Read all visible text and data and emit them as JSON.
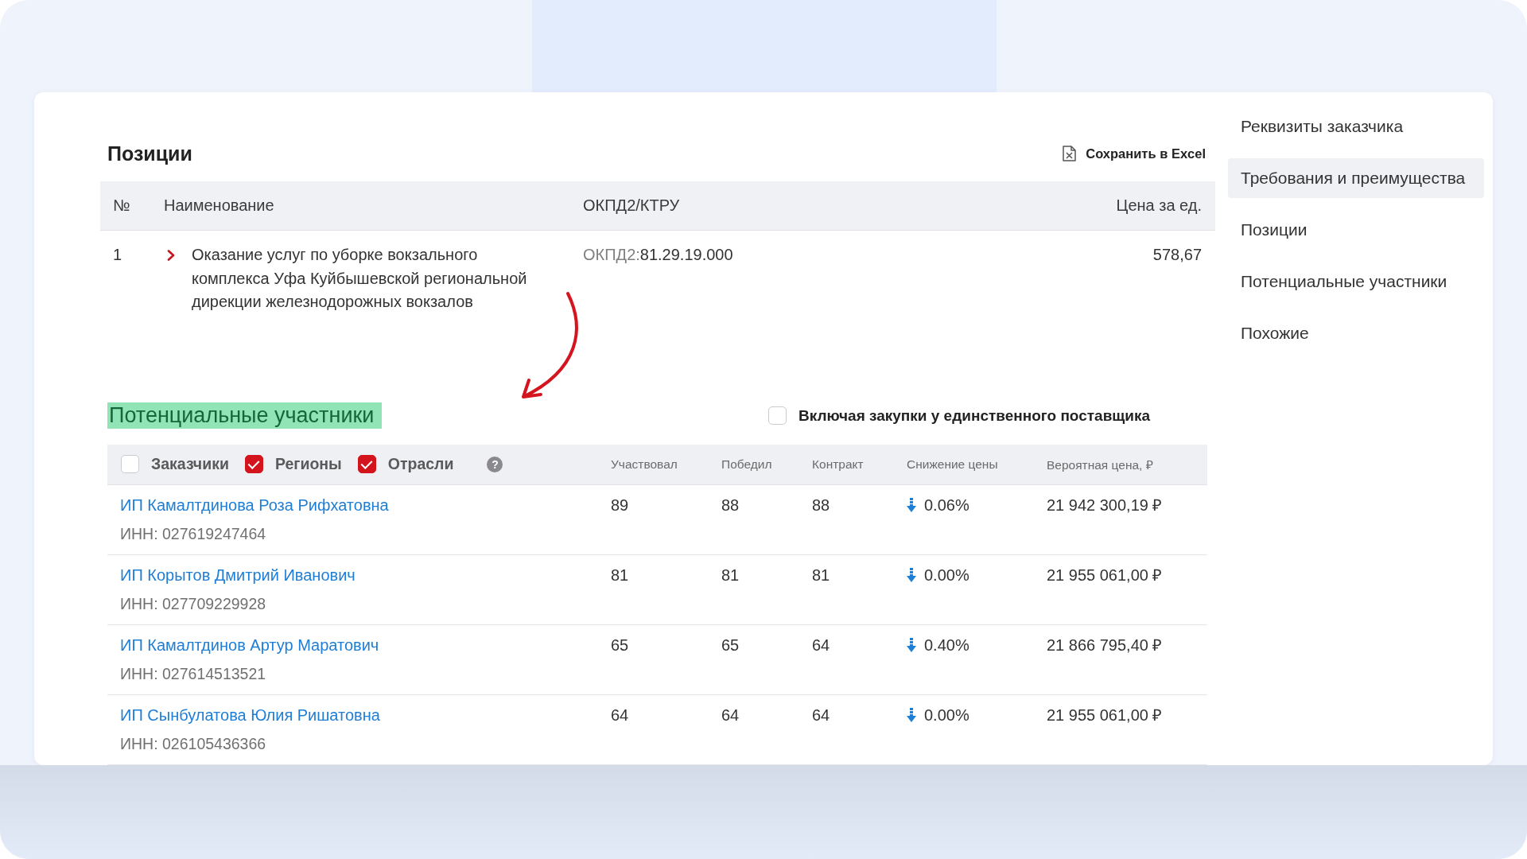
{
  "positions": {
    "title": "Позиции",
    "export_button": "Сохранить в Excel",
    "columns": [
      "№",
      "Наименование",
      "ОКПД2/КТРУ",
      "Цена за ед."
    ],
    "rows": [
      {
        "number": "1",
        "expanded": false,
        "name": "Оказание услуг по уборке вокзального комплекса Уфа Куйбышевской региональной дирекции железнодорожных вокзалов",
        "okpd_label": "ОКПД2:",
        "okpd_code": "81.29.19.000",
        "price": "578,67"
      }
    ]
  },
  "participants": {
    "heading": {
      "text": "Потенциальные участники",
      "highlighted": true
    },
    "include_single_supplier": {
      "label": "Включая закупки у единственного поставщика",
      "checked": false
    },
    "filters": [
      {
        "label": "Заказчики",
        "checked": false
      },
      {
        "label": "Регионы",
        "checked": true
      },
      {
        "label": "Отрасли",
        "checked": true
      }
    ],
    "help_icon": "?",
    "columns": [
      "Участвовал",
      "Победил",
      "Контракт",
      "Снижение цены",
      "Вероятная цена, ₽"
    ],
    "rows": [
      {
        "name": "ИП Камалтдинова Роза Рифхатовна",
        "inn": "ИНН: 027619247464",
        "participated": "89",
        "won": "88",
        "contracts": "88",
        "price_drop": "0.06%",
        "probable_price": "21 942 300,19 ₽"
      },
      {
        "name": "ИП Корытов Дмитрий Иванович",
        "inn": "ИНН: 027709229928",
        "participated": "81",
        "won": "81",
        "contracts": "81",
        "price_drop": "0.00%",
        "probable_price": "21 955 061,00 ₽"
      },
      {
        "name": "ИП Камалтдинов Артур Маратович",
        "inn": "ИНН: 027614513521",
        "participated": "65",
        "won": "65",
        "contracts": "64",
        "price_drop": "0.40%",
        "probable_price": "21 866 795,40 ₽"
      },
      {
        "name": "ИП Сынбулатова Юлия Ришатовна",
        "inn": "ИНН: 026105436366",
        "participated": "64",
        "won": "64",
        "contracts": "64",
        "price_drop": "0.00%",
        "probable_price": "21 955 061,00 ₽"
      }
    ]
  },
  "sidebar": {
    "items": [
      {
        "label": "Реквизиты заказчика",
        "selected": false
      },
      {
        "label": "Требования и преимущества",
        "selected": true
      },
      {
        "label": "Позиции",
        "selected": false
      },
      {
        "label": "Потенциальные участники",
        "selected": false
      },
      {
        "label": "Похожие",
        "selected": false
      }
    ]
  }
}
